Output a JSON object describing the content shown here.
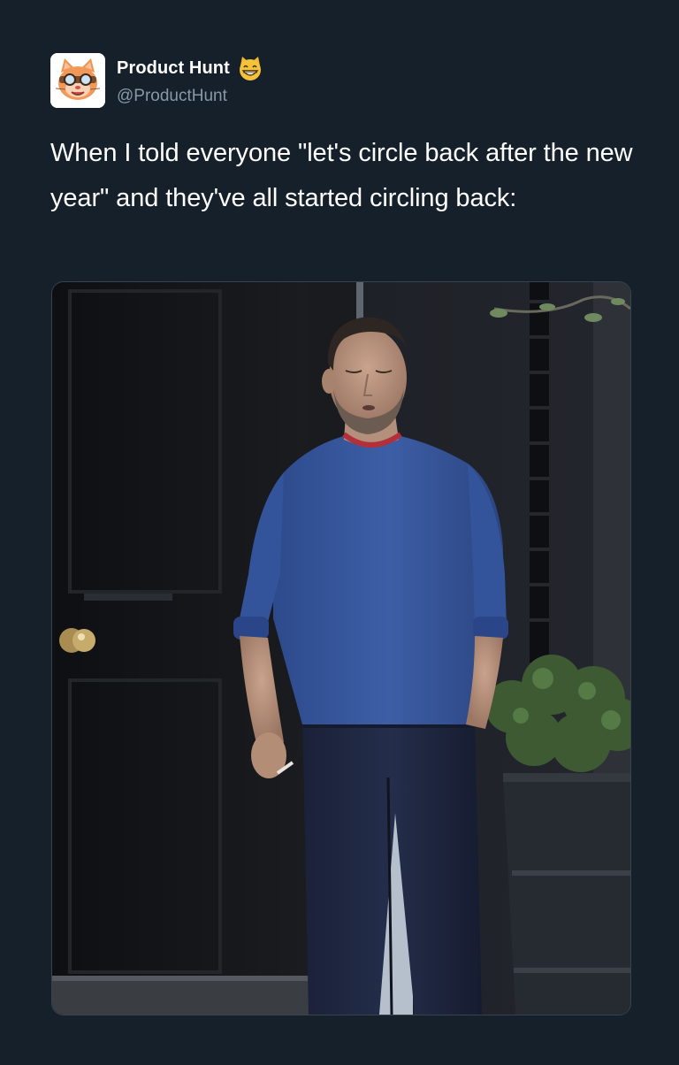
{
  "tweet": {
    "author": {
      "display_name": "Product Hunt",
      "handle": "@ProductHunt",
      "avatar_icon": "product-hunt-kitty-avatar",
      "badge_emoji": "grinning-cat-emoji"
    },
    "text": "When I told everyone \"let's circle back after the new year\" and they've all started circling back:",
    "media": {
      "type": "photo",
      "subject": "man-in-blue-sweater-exhaling-smoke"
    }
  },
  "colors": {
    "background": "#15202b",
    "text_primary": "#ffffff",
    "text_secondary": "#8899a6",
    "media_border": "#38444d"
  }
}
